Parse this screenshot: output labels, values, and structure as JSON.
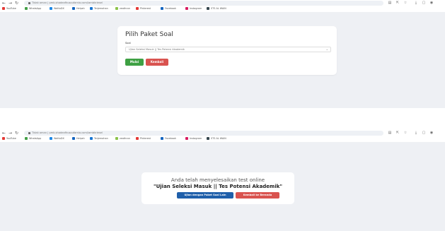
{
  "browser": {
    "url": "Tidak aman | pmb.shadeafhusoufamia.com/iambkriesel",
    "bookmarks": [
      {
        "label": "YouTube",
        "color": "#e53935"
      },
      {
        "label": "WhatsApp",
        "color": "#43a047"
      },
      {
        "label": "WaNuDX",
        "color": "#1e88e5"
      },
      {
        "label": "Helpsh",
        "color": "#1565c0"
      },
      {
        "label": "Terjemahan",
        "color": "#1976d2"
      },
      {
        "label": "zeathron",
        "color": "#8bc34a"
      },
      {
        "label": "Pinterest",
        "color": "#e53935"
      },
      {
        "label": "Facebook",
        "color": "#1565c0"
      },
      {
        "label": "Instagram",
        "color": "#d81b60"
      },
      {
        "label": "STS AL WAIN",
        "color": "#37474f"
      }
    ]
  },
  "select_page": {
    "title": "Pilih Paket Soal",
    "field_label": "Soal",
    "selected_value": "Ujian Seleksi Masuk || Tes Potensi Akademik",
    "start_button": "Mulai",
    "back_button": "Kembali",
    "start_color": "#3ea043",
    "back_color": "#d9534f"
  },
  "finished_page": {
    "message": "Anda telah menyelesaikan test online",
    "exam_name": "\"Ujian Seleksi Masuk || Tes Potensi Akademik\"",
    "retry_button": "Ujian dengan Paket Soal Lain",
    "home_button": "Kembali ke Beranda",
    "retry_color": "#1f5faa",
    "home_color": "#d9534f"
  }
}
